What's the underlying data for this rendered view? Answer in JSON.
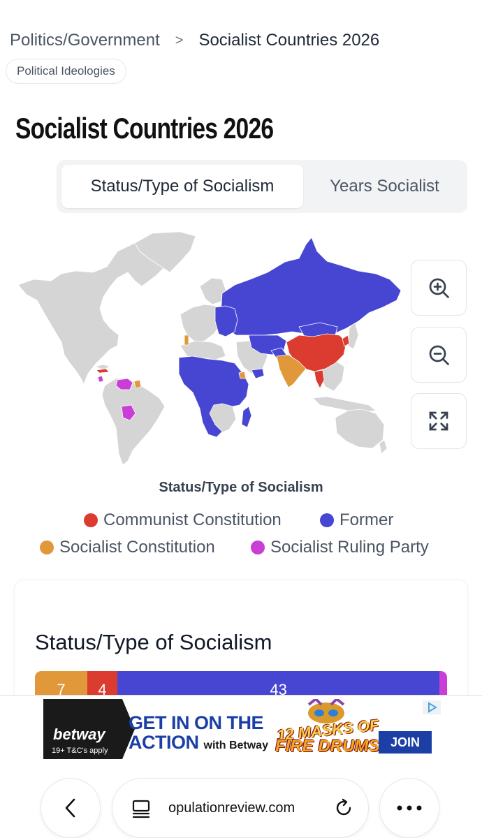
{
  "breadcrumb": {
    "parent": "Politics/Government",
    "separator": ">",
    "current": "Socialist Countries 2026"
  },
  "tag": "Political Ideologies",
  "page_title": "Socialist Countries 2026",
  "tabs": [
    {
      "label": "Status/Type of Socialism",
      "active": true
    },
    {
      "label": "Years Socialist",
      "active": false
    }
  ],
  "map": {
    "zoom_controls": [
      "zoom-in-icon",
      "zoom-out-icon",
      "fullscreen-icon"
    ]
  },
  "legend": {
    "title": "Status/Type of Socialism",
    "items": [
      {
        "label": "Communist Constitution",
        "color": "#dc3b2f"
      },
      {
        "label": "Former",
        "color": "#4746d3"
      },
      {
        "label": "Socialist Constitution",
        "color": "#e1983a"
      },
      {
        "label": "Socialist Ruling Party",
        "color": "#c93fd6"
      }
    ]
  },
  "breakdown": {
    "title": "Status/Type of Socialism",
    "segments": [
      {
        "label": "Socialist Constitution",
        "value": 7,
        "color": "#e1983a"
      },
      {
        "label": "Communist Constitution",
        "value": 4,
        "color": "#dc3b2f"
      },
      {
        "label": "Former",
        "value": 43,
        "color": "#4746d3"
      },
      {
        "label": "Socialist Ruling Party",
        "value": 1,
        "color": "#c93fd6"
      }
    ]
  },
  "ad": {
    "brand": "betway",
    "terms": "19+ T&C's apply",
    "headline_1": "GET IN ON THE",
    "headline_2": "ACTION",
    "headline_small": "with Betway",
    "game_line_1": "12 MASKS OF",
    "game_line_2": "FIRE DRUMS",
    "cta": "JOIN"
  },
  "browser": {
    "url": "opulationreview.com",
    "icons": [
      "back-icon",
      "page-icon",
      "reload-icon",
      "more-icon"
    ]
  }
}
